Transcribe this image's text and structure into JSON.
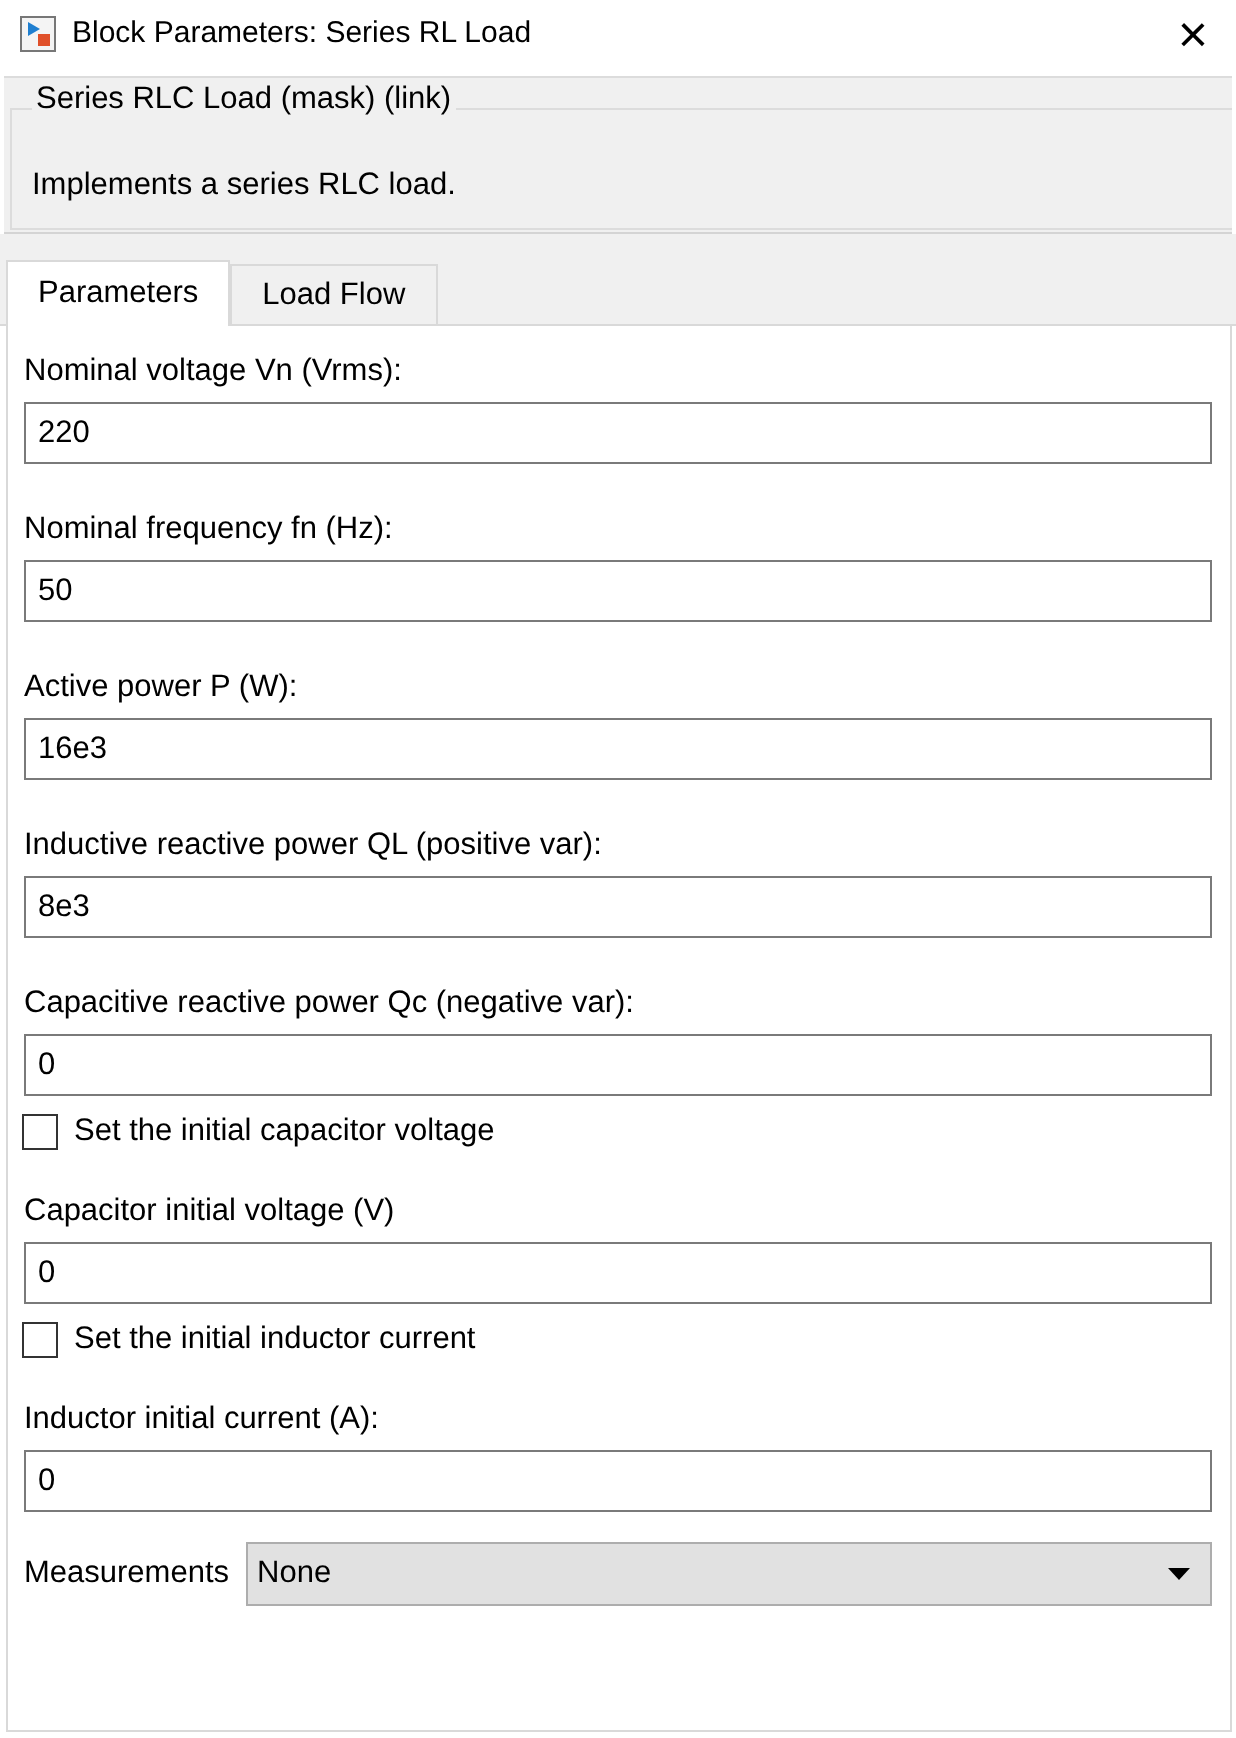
{
  "window": {
    "title": "Block Parameters: Series RL Load",
    "close": "×"
  },
  "group": {
    "title": "Series RLC Load (mask) (link)",
    "description": "Implements a series RLC load."
  },
  "tabs": [
    {
      "label": "Parameters",
      "selected": true
    },
    {
      "label": "Load Flow",
      "selected": false
    }
  ],
  "parameters": [
    {
      "kind": "field",
      "label": "Nominal voltage Vn (Vrms):",
      "value": "220"
    },
    {
      "kind": "field",
      "label": "Nominal frequency fn (Hz):",
      "value": "50"
    },
    {
      "kind": "field",
      "label": "Active power P (W):",
      "value": "16e3"
    },
    {
      "kind": "field",
      "label": "Inductive reactive power QL (positive var):",
      "value": "8e3"
    },
    {
      "kind": "field",
      "label": "Capacitive reactive power Qc (negative var):",
      "value": "0"
    },
    {
      "kind": "checkbox",
      "label": "Set the initial capacitor voltage",
      "checked": false
    },
    {
      "kind": "field",
      "label": "Capacitor initial voltage (V)",
      "value": "0"
    },
    {
      "kind": "checkbox",
      "label": "Set the initial inductor current",
      "checked": false
    },
    {
      "kind": "field",
      "label": "Inductor initial current (A):",
      "value": "0"
    },
    {
      "kind": "dropdown",
      "label": "Measurements",
      "value": "None"
    }
  ]
}
